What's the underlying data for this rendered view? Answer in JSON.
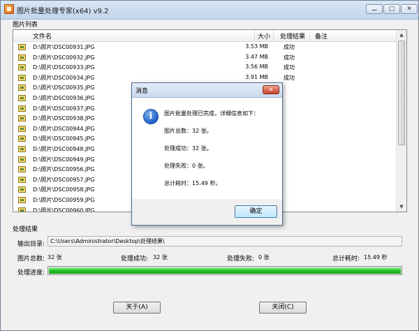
{
  "window": {
    "title": "图片批量处理专家(x64) v9.2",
    "controls": [
      "⚊",
      "▢",
      "✕"
    ]
  },
  "file_list": {
    "label": "图片列表",
    "columns": [
      "文件名",
      "大小",
      "处理结果",
      "备注"
    ],
    "rows": [
      {
        "name": "D:\\照片\\DSC00931.JPG",
        "size": "3.53 MB",
        "status": "成功"
      },
      {
        "name": "D:\\照片\\DSC00932.JPG",
        "size": "3.47 MB",
        "status": "成功"
      },
      {
        "name": "D:\\照片\\DSC00933.JPG",
        "size": "3.56 MB",
        "status": "成功"
      },
      {
        "name": "D:\\照片\\DSC00934.JPG",
        "size": "3.91 MB",
        "status": "成功"
      },
      {
        "name": "D:\\照片\\DSC00935.JPG",
        "size": "",
        "status": ""
      },
      {
        "name": "D:\\照片\\DSC00936.JPG",
        "size": "",
        "status": ""
      },
      {
        "name": "D:\\照片\\DSC00937.JPG",
        "size": "",
        "status": ""
      },
      {
        "name": "D:\\照片\\DSC00938.JPG",
        "size": "",
        "status": ""
      },
      {
        "name": "D:\\照片\\DSC00944.JPG",
        "size": "",
        "status": ""
      },
      {
        "name": "D:\\照片\\DSC00945.JPG",
        "size": "",
        "status": ""
      },
      {
        "name": "D:\\照片\\DSC00948.JPG",
        "size": "",
        "status": ""
      },
      {
        "name": "D:\\照片\\DSC00949.JPG",
        "size": "",
        "status": ""
      },
      {
        "name": "D:\\照片\\DSC00956.JPG",
        "size": "",
        "status": ""
      },
      {
        "name": "D:\\照片\\DSC00957.JPG",
        "size": "",
        "status": ""
      },
      {
        "name": "D:\\照片\\DSC00958.JPG",
        "size": "",
        "status": ""
      },
      {
        "name": "D:\\照片\\DSC00959.JPG",
        "size": "",
        "status": ""
      },
      {
        "name": "D:\\照片\\DSC00960.JPG",
        "size": "",
        "status": ""
      }
    ],
    "scroll_up": "▲",
    "scroll_down": "▼"
  },
  "results": {
    "label": "处理结果",
    "output_dir_label": "输出目录:",
    "output_dir": "C:\\Users\\Administrator\\Desktop\\处理结果\\",
    "total_label": "图片总数:",
    "total_value": "32 张",
    "success_label": "处理成功:",
    "success_value": "32 张",
    "fail_label": "处理失败:",
    "fail_value": "0 张",
    "time_label": "总计耗时:",
    "time_value": "15.49 秒",
    "progress_label": "处理进度:",
    "progress_fraction": 1.0
  },
  "buttons": {
    "about": "关于(A)",
    "close": "关闭(C)"
  },
  "dialog": {
    "title": "消息",
    "close_glyph": "✕",
    "icon_glyph": "i",
    "lines": [
      "图片批量处理已完成，详细信息如下：",
      "图片总数：32 张。",
      "处理成功：32 张。",
      "处理失败：0 张。",
      "总计耗时：15.49 秒。"
    ],
    "ok_label": "确定"
  },
  "colors": {
    "progress": "#25c125",
    "dialog_close": "#c6432b",
    "info_icon": "#1f5fc6"
  }
}
